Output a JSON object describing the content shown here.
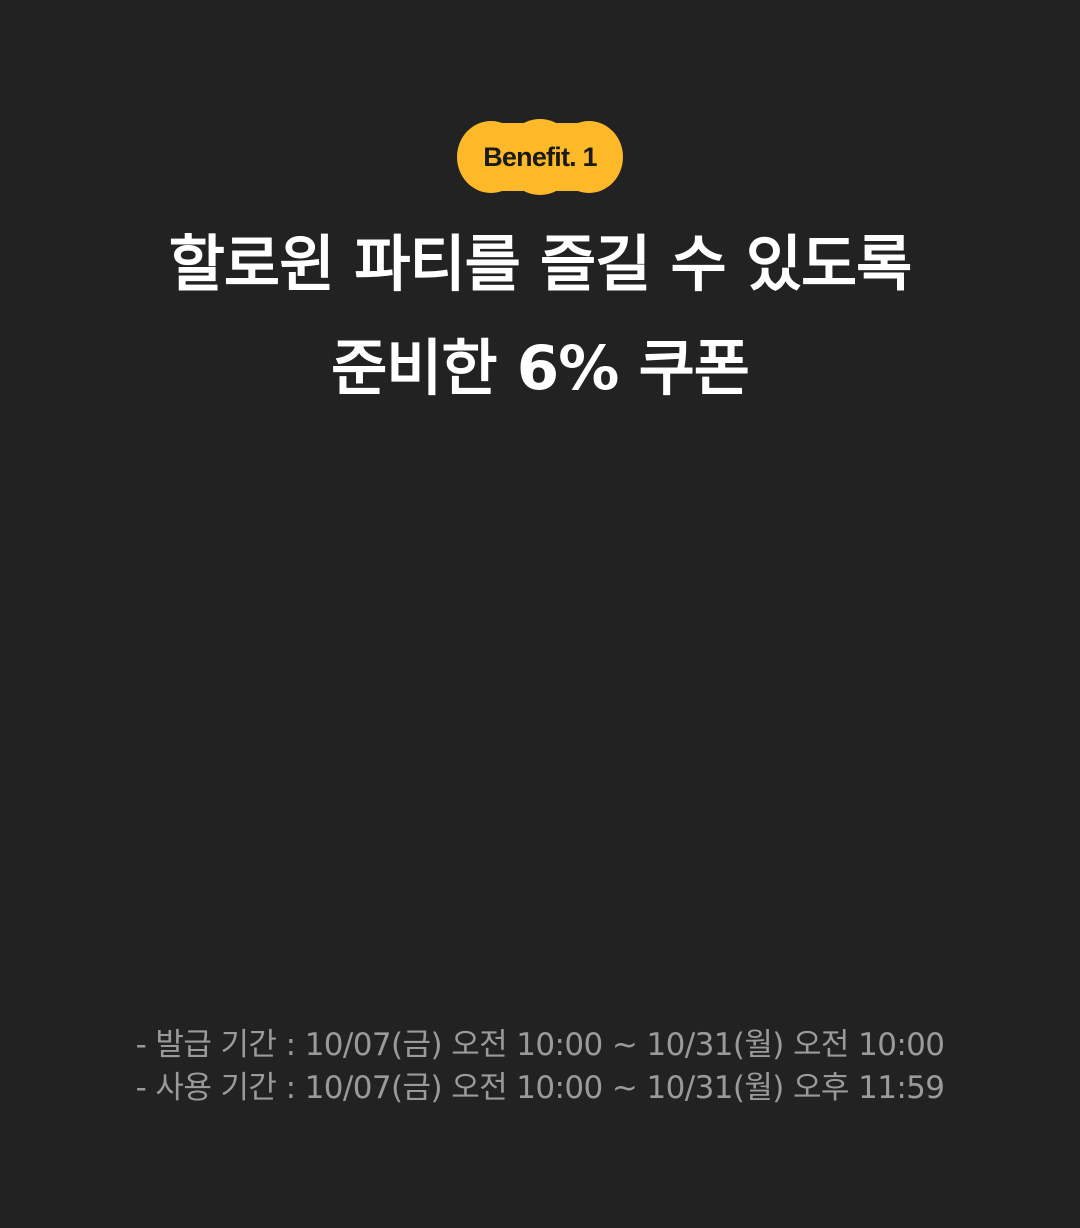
{
  "badge": {
    "label": "Benefit. 1",
    "color": "#FDB927"
  },
  "headline": {
    "line1": "할로윈 파티를 즐길 수 있도록",
    "line2": "준비한 6% 쿠폰"
  },
  "periods": {
    "issue": "- 발급 기간 : 10/07(금) 오전 10:00 ~ 10/31(월) 오전 10:00",
    "use": "- 사용 기간 : 10/07(금) 오전 10:00 ~ 10/31(월) 오후 11:59"
  },
  "colors": {
    "background": "#222222",
    "headline_text": "#FFFFFF",
    "period_text": "#9A9A9A",
    "badge_text": "#1A1A1A"
  }
}
